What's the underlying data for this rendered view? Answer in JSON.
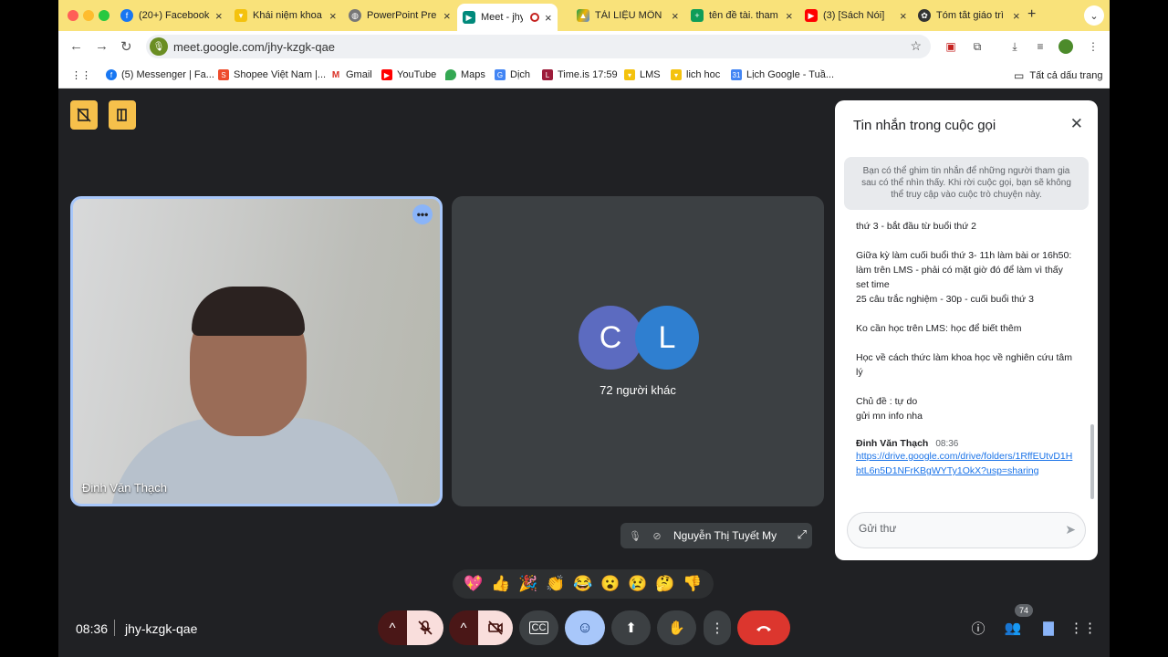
{
  "colors": {
    "tabstrip_bg": "#f9e27a",
    "meet_bg": "#202124",
    "highlight_border": "#a8c7fa",
    "mic_off_bg": "#f9dedc",
    "end_call_bg": "#dc362e",
    "reaction_active_bg": "#a8c7fa",
    "host_control_bg": "#f6c04b",
    "avatar_c": "#5c6bc0",
    "avatar_l": "#2f7fd0",
    "chat_active_icon": "#8ab4f8"
  },
  "browser": {
    "tabs": [
      {
        "title": "(20+) Facebook",
        "icon": "facebook-icon"
      },
      {
        "title": "Khái niệm khoa",
        "icon": "lms-icon"
      },
      {
        "title": "PowerPoint Pre",
        "icon": "globe-icon"
      },
      {
        "title": "Meet - jhy-",
        "icon": "meet-icon",
        "active": true
      },
      {
        "title": "TÀI LIỆU MÔN",
        "icon": "drive-icon"
      },
      {
        "title": "tên đề tài. tham",
        "icon": "sheets-icon"
      },
      {
        "title": "(3) [Sách Nói]",
        "icon": "youtube-icon"
      },
      {
        "title": "Tóm tắt giáo trì",
        "icon": "chatgpt-icon"
      }
    ],
    "new_tab_label": "+",
    "url": "meet.google.com/jhy-kzgk-qae",
    "bookmarks": [
      {
        "label": "(5) Messenger | Fa...",
        "icon": "facebook-icon"
      },
      {
        "label": "Shopee Việt Nam |...",
        "icon": "shopee-icon"
      },
      {
        "label": "Gmail",
        "icon": "gmail-icon"
      },
      {
        "label": "YouTube",
        "icon": "youtube-icon"
      },
      {
        "label": "Maps",
        "icon": "maps-icon"
      },
      {
        "label": "Dịch",
        "icon": "translate-icon"
      },
      {
        "label": "Time.is 17:59",
        "icon": "timeis-icon"
      },
      {
        "label": "LMS",
        "icon": "lms-icon"
      },
      {
        "label": "lich hoc",
        "icon": "lms-icon"
      },
      {
        "label": "Lịch Google - Tuầ...",
        "icon": "calendar-icon"
      }
    ],
    "all_bookmarks": "Tất cả dấu trang"
  },
  "meet": {
    "speaker_name": "Đinh Văn Thạch",
    "avatars": [
      {
        "letter": "C",
        "icon": "avatar-c"
      },
      {
        "letter": "L",
        "icon": "avatar-l"
      }
    ],
    "others_label": "72 người khác",
    "self_name": "Nguyễn Thị Tuyết My",
    "reactions": [
      "💖",
      "👍",
      "🎉",
      "👏",
      "😂",
      "😮",
      "😢",
      "🤔",
      "👎"
    ],
    "time": "08:36",
    "code": "jhy-kzgk-qae",
    "participants_count": "74"
  },
  "chat": {
    "title": "Tin nhắn trong cuộc gọi",
    "notice": "Bạn có thể ghim tin nhắn để những người tham gia sau có thể nhìn thấy. Khi rời cuộc gọi, bạn sẽ không thể truy cập vào cuộc trò chuyện này.",
    "messages": [
      "thứ 3 - bắt đầu từ buổi thứ 2",
      "",
      "Giữa kỳ làm cuối buổi thứ 3- 11h làm bài or 16h50: làm trên LMS - phải có mặt giờ đó để làm vì thấy set time",
      "25 câu trắc nghiệm - 30p - cuối buổi thứ 3",
      "",
      "Ko cần học trên LMS: học để biết thêm",
      "",
      "Học về cách thức làm khoa học về nghiên cứu tâm lý",
      "",
      "Chủ đề : tự do",
      "gửi mn info nha"
    ],
    "last_sender": "Đinh Văn Thạch",
    "last_time": "08:36",
    "last_link": "https://drive.google.com/drive/folders/1RffEUtvD1HbtL6n5D1NFrKBgWYTy1OkX?usp=sharing",
    "input_placeholder": "Gửi thư"
  }
}
